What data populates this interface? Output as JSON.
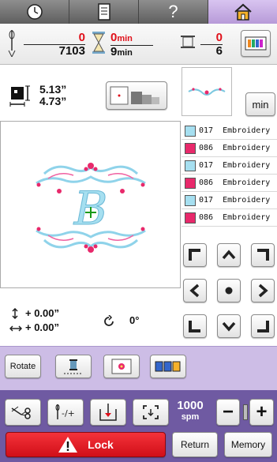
{
  "tabs": [
    {
      "icon": "clock-icon"
    },
    {
      "icon": "document-icon"
    },
    {
      "icon": "help-icon",
      "label": "?"
    },
    {
      "icon": "home-icon"
    }
  ],
  "status": {
    "stitch_current": "0",
    "stitch_total": "7103",
    "time_current": "0",
    "time_total": "9",
    "time_unit": "min",
    "color_current": "0",
    "color_total": "6"
  },
  "size": {
    "height": "5.13”",
    "width": "4.73”"
  },
  "min_label": "min",
  "threads": [
    {
      "code": "017",
      "name": "Embroidery",
      "color": "#a6dff0"
    },
    {
      "code": "086",
      "name": "Embroidery",
      "color": "#e8296b"
    },
    {
      "code": "017",
      "name": "Embroidery",
      "color": "#a6dff0"
    },
    {
      "code": "086",
      "name": "Embroidery",
      "color": "#e8296b"
    },
    {
      "code": "017",
      "name": "Embroidery",
      "color": "#a6dff0"
    },
    {
      "code": "086",
      "name": "Embroidery",
      "color": "#e8296b"
    }
  ],
  "position": {
    "y_offset": "+ 0.00”",
    "x_offset": "+ 0.00”",
    "angle": "0°"
  },
  "design_letter": "B",
  "toolbar": {
    "rotate_label": "Rotate",
    "speed_value": "1000",
    "speed_unit": "spm",
    "minus_label": "−",
    "plus_label": "+"
  },
  "actions": {
    "lock_label": "Lock",
    "return_label": "Return",
    "memory_label": "Memory"
  },
  "colors": {
    "accent_purple": "#6f5aa2",
    "lock_red": "#e0101a",
    "thread_blue": "#a6dff0",
    "thread_pink": "#e8296b"
  }
}
